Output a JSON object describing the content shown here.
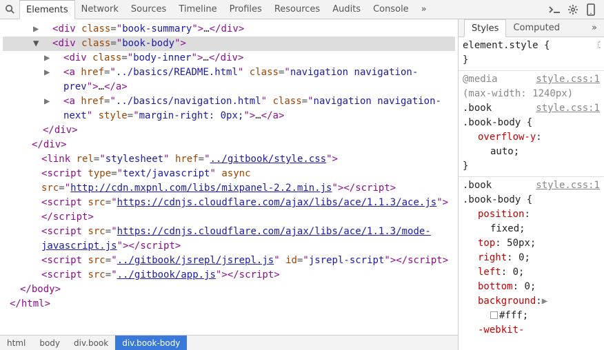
{
  "toolbar": {
    "tabs": [
      "Elements",
      "Network",
      "Sources",
      "Timeline",
      "Profiles",
      "Resources",
      "Audits",
      "Console"
    ],
    "activeTab": 0,
    "overflow": "»",
    "drawerIcon": ">_",
    "settingsIcon": "gear",
    "deviceIcon": "device"
  },
  "dom": {
    "l0": {
      "arrow": "▶",
      "tag": "div",
      "attrs": [
        {
          "n": "class",
          "v": "book-summary"
        }
      ],
      "ellipsis": "…",
      "close": "div"
    },
    "l1": {
      "arrow": "▼",
      "tag": "div",
      "attrs": [
        {
          "n": "class",
          "v": "book-body"
        }
      ]
    },
    "l2": {
      "arrow": "▶",
      "tag": "div",
      "attrs": [
        {
          "n": "class",
          "v": "body-inner"
        }
      ],
      "ellipsis": "…",
      "close": "div"
    },
    "l3": {
      "arrow": "▶",
      "tag": "a",
      "attrs": [
        {
          "n": "href",
          "v": "../basics/README.html"
        },
        {
          "n": "class",
          "v": "navigation navigation-prev"
        }
      ],
      "ellipsis": "…",
      "close": "a"
    },
    "l4": {
      "arrow": "▶",
      "tag": "a",
      "attrs": [
        {
          "n": "href",
          "v": "../basics/navigation.html"
        },
        {
          "n": "class",
          "v": "navigation navigation-next"
        },
        {
          "n": "style",
          "v": "margin-right: 0px;"
        }
      ],
      "ellipsis": "…",
      "close": "a"
    },
    "c_bookbody": "</div>",
    "c_book": "</div>",
    "l5": {
      "tag": "link",
      "attrs": [
        {
          "n": "rel",
          "v": "stylesheet"
        },
        {
          "n": "href",
          "v": "../gitbook/style.css",
          "u": true
        }
      ]
    },
    "l6": {
      "tag": "script",
      "attrs": [
        {
          "n": "type",
          "v": "text/javascript"
        },
        {
          "n": "async",
          "bare": true
        },
        {
          "n": "src",
          "v": "http://cdn.mxpnl.com/libs/mixpanel-2.2.min.js",
          "u": true
        }
      ],
      "close": "script"
    },
    "l7": {
      "tag": "script",
      "attrs": [
        {
          "n": "src",
          "v": "https://cdnjs.cloudflare.com/ajax/libs/ace/1.1.3/ace.js",
          "u": true
        }
      ],
      "close": "script"
    },
    "l8": {
      "tag": "script",
      "attrs": [
        {
          "n": "src",
          "v": "https://cdnjs.cloudflare.com/ajax/libs/ace/1.1.3/mode-javascript.js",
          "u": true
        }
      ],
      "close": "script"
    },
    "l9": {
      "tag": "script",
      "attrs": [
        {
          "n": "src",
          "v": "../gitbook/jsrepl/jsrepl.js",
          "u": true
        },
        {
          "n": "id",
          "v": "jsrepl-script"
        }
      ],
      "close": "script"
    },
    "l10": {
      "tag": "script",
      "attrs": [
        {
          "n": "src",
          "v": "../gitbook/app.js",
          "u": true
        }
      ],
      "close": "script"
    },
    "c_body": "</body>",
    "c_html": "</html>"
  },
  "breadcrumbs": [
    "html",
    "body",
    "div.book",
    "div.book-body"
  ],
  "sidebar": {
    "tabs": [
      "Styles",
      "Computed"
    ],
    "overflow": "»",
    "sections": {
      "element_style": {
        "selector": "element.style",
        "open": "{",
        "close": "}"
      },
      "media_rule": {
        "media": "@media",
        "media_text": "(max-width: 1240px)",
        "media_src": "style.css:1",
        "sel1": ".book",
        "src1": "style.css:1",
        "sel2": ".book-body {",
        "decls": [
          {
            "prop": "overflow-y",
            "val": "auto",
            "indent": true
          }
        ],
        "close": "}"
      },
      "main_rule": {
        "sel1": ".book",
        "src1": "style.css:1",
        "sel2": ".book-body {",
        "decls": [
          {
            "prop": "position",
            "val": "fixed"
          },
          {
            "prop": "top",
            "val": "50px"
          },
          {
            "prop": "right",
            "val": "0"
          },
          {
            "prop": "left",
            "val": "0"
          },
          {
            "prop": "bottom",
            "val": "0"
          },
          {
            "prop": "background",
            "val": "#fff",
            "swatch": true,
            "expand": true
          },
          {
            "prop": "-webkit-",
            "partial": true
          }
        ]
      }
    }
  }
}
